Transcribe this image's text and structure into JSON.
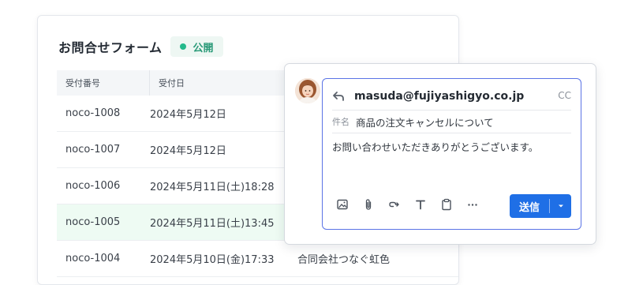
{
  "form": {
    "title": "お問合せフォーム",
    "status": "公開",
    "columns": [
      "受付番号",
      "受付日"
    ],
    "rows": [
      {
        "id": "noco-1008",
        "date": "2024年5月12日",
        "company": ""
      },
      {
        "id": "noco-1007",
        "date": "2024年5月12日",
        "company": ""
      },
      {
        "id": "noco-1006",
        "date": "2024年5月11日(土)18:28",
        "company": ""
      },
      {
        "id": "noco-1005",
        "date": "2024年5月11日(土)13:45",
        "company": ""
      },
      {
        "id": "noco-1004",
        "date": "2024年5月10日(金)17:33",
        "company": "合同会社つなぐ虹色"
      }
    ]
  },
  "composer": {
    "to": "masuda@fujiyashigyo.co.jp",
    "cc_label": "CC",
    "subject_label": "件名",
    "subject": "商品の注文キャンセルについて",
    "body": "お問い合わせいただきありがとうございます。",
    "send_label": "送信",
    "toolbar_icons": [
      "image-icon",
      "paperclip-icon",
      "link-icon",
      "text-format-icon",
      "clipboard-icon",
      "more-icon"
    ]
  },
  "colors": {
    "accent": "#1f6fe6",
    "editor_border": "#5b74e6",
    "status_green": "#23b98b",
    "row_highlight": "#eefbf3"
  }
}
